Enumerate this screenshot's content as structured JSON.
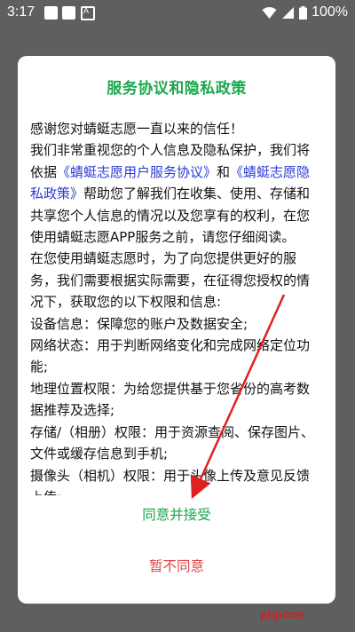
{
  "status_bar": {
    "time": "3:17",
    "battery_percent": "100%",
    "icons": [
      "notification-square-icon",
      "notification-square-icon",
      "text-box-a-icon",
      "wifi-icon",
      "cell-signal-icon",
      "battery-icon"
    ]
  },
  "dialog": {
    "title": "服务协议和隐私政策",
    "intro_line": "感谢您对蜻蜓志愿一直以来的信任！",
    "para1_prefix": "我们非常重视您的个人信息及隐私保护，我们将依据",
    "link_user_agreement": "《蜻蜓志愿用户服务协议》",
    "para1_and": "和",
    "link_privacy_policy": "《蜻蜓志愿隐私政策》",
    "para1_suffix": "帮助您了解我们在收集、使用、存储和共享您个人信息的情况以及您享有的权利，在您使用蜻蜓志愿APP服务之前，请您仔细阅读。",
    "para2": "在您使用蜻蜓志愿时，为了向您提供更好的服务，我们需要根据实际需要，在征得您授权的情况下，获取您的以下权限和信息:",
    "perm_device": "设备信息：保障您的账户及数据安全;",
    "perm_network": "网络状态：用于判断网络变化和完成网络定位功能;",
    "perm_location": "地理位置权限：为给您提供基于您省份的高考数据推荐及选择;",
    "perm_storage": "存储/（相册）权限：用于资源查阅、保存图片、文件或缓存信息到手机;",
    "perm_camera": "摄像头（相机）权限：用于头像上传及意见反馈上传;",
    "agree_button": "同意并接受",
    "disagree_button": "暂不同意"
  },
  "watermark": "phpcms",
  "colors": {
    "title_green": "#1aa84e",
    "link_blue": "#2b3cd6",
    "disagree_red": "#e04545",
    "arrow_red": "#e02020",
    "backdrop": "#5f5f5f"
  }
}
